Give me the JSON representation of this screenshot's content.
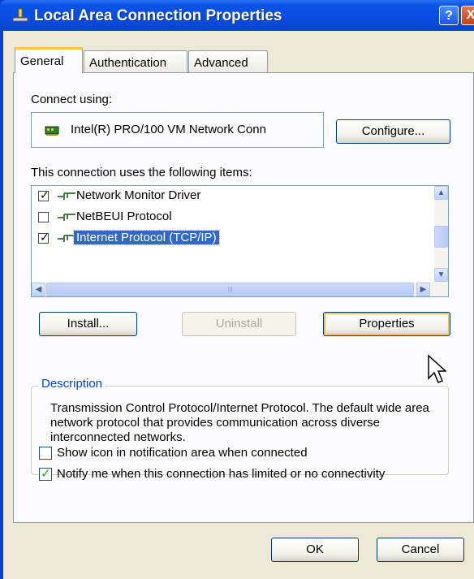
{
  "window": {
    "title": "Local Area Connection Properties",
    "help_label": "?",
    "close_label": "X"
  },
  "tabs": [
    {
      "label": "General",
      "active": true
    },
    {
      "label": "Authentication",
      "active": false
    },
    {
      "label": "Advanced",
      "active": false
    }
  ],
  "general": {
    "connect_using_label": "Connect using:",
    "adapter_name": "Intel(R) PRO/100 VM Network Conn",
    "configure_button": "Configure...",
    "items_label": "This connection uses the following items:",
    "items": [
      {
        "label": "Network Monitor Driver",
        "checked": true,
        "selected": false
      },
      {
        "label": "NetBEUI Protocol",
        "checked": false,
        "selected": false
      },
      {
        "label": "Internet Protocol (TCP/IP)",
        "checked": true,
        "selected": true
      }
    ],
    "install_button": "Install...",
    "uninstall_button": "Uninstall",
    "properties_button": "Properties",
    "description_legend": "Description",
    "description_text": "Transmission Control Protocol/Internet Protocol. The default wide area network protocol that provides communication across diverse interconnected networks.",
    "show_icon_label": "Show icon in notification area when connected",
    "show_icon_checked": false,
    "notify_label": "Notify me when this connection has limited or no connectivity",
    "notify_checked": true
  },
  "footer": {
    "ok_button": "OK",
    "cancel_button": "Cancel"
  },
  "colors": {
    "titlebar": "#0a52e6",
    "selection": "#316ac5",
    "description_legend": "#0046d5",
    "dialog_bg": "#ece9d8"
  }
}
